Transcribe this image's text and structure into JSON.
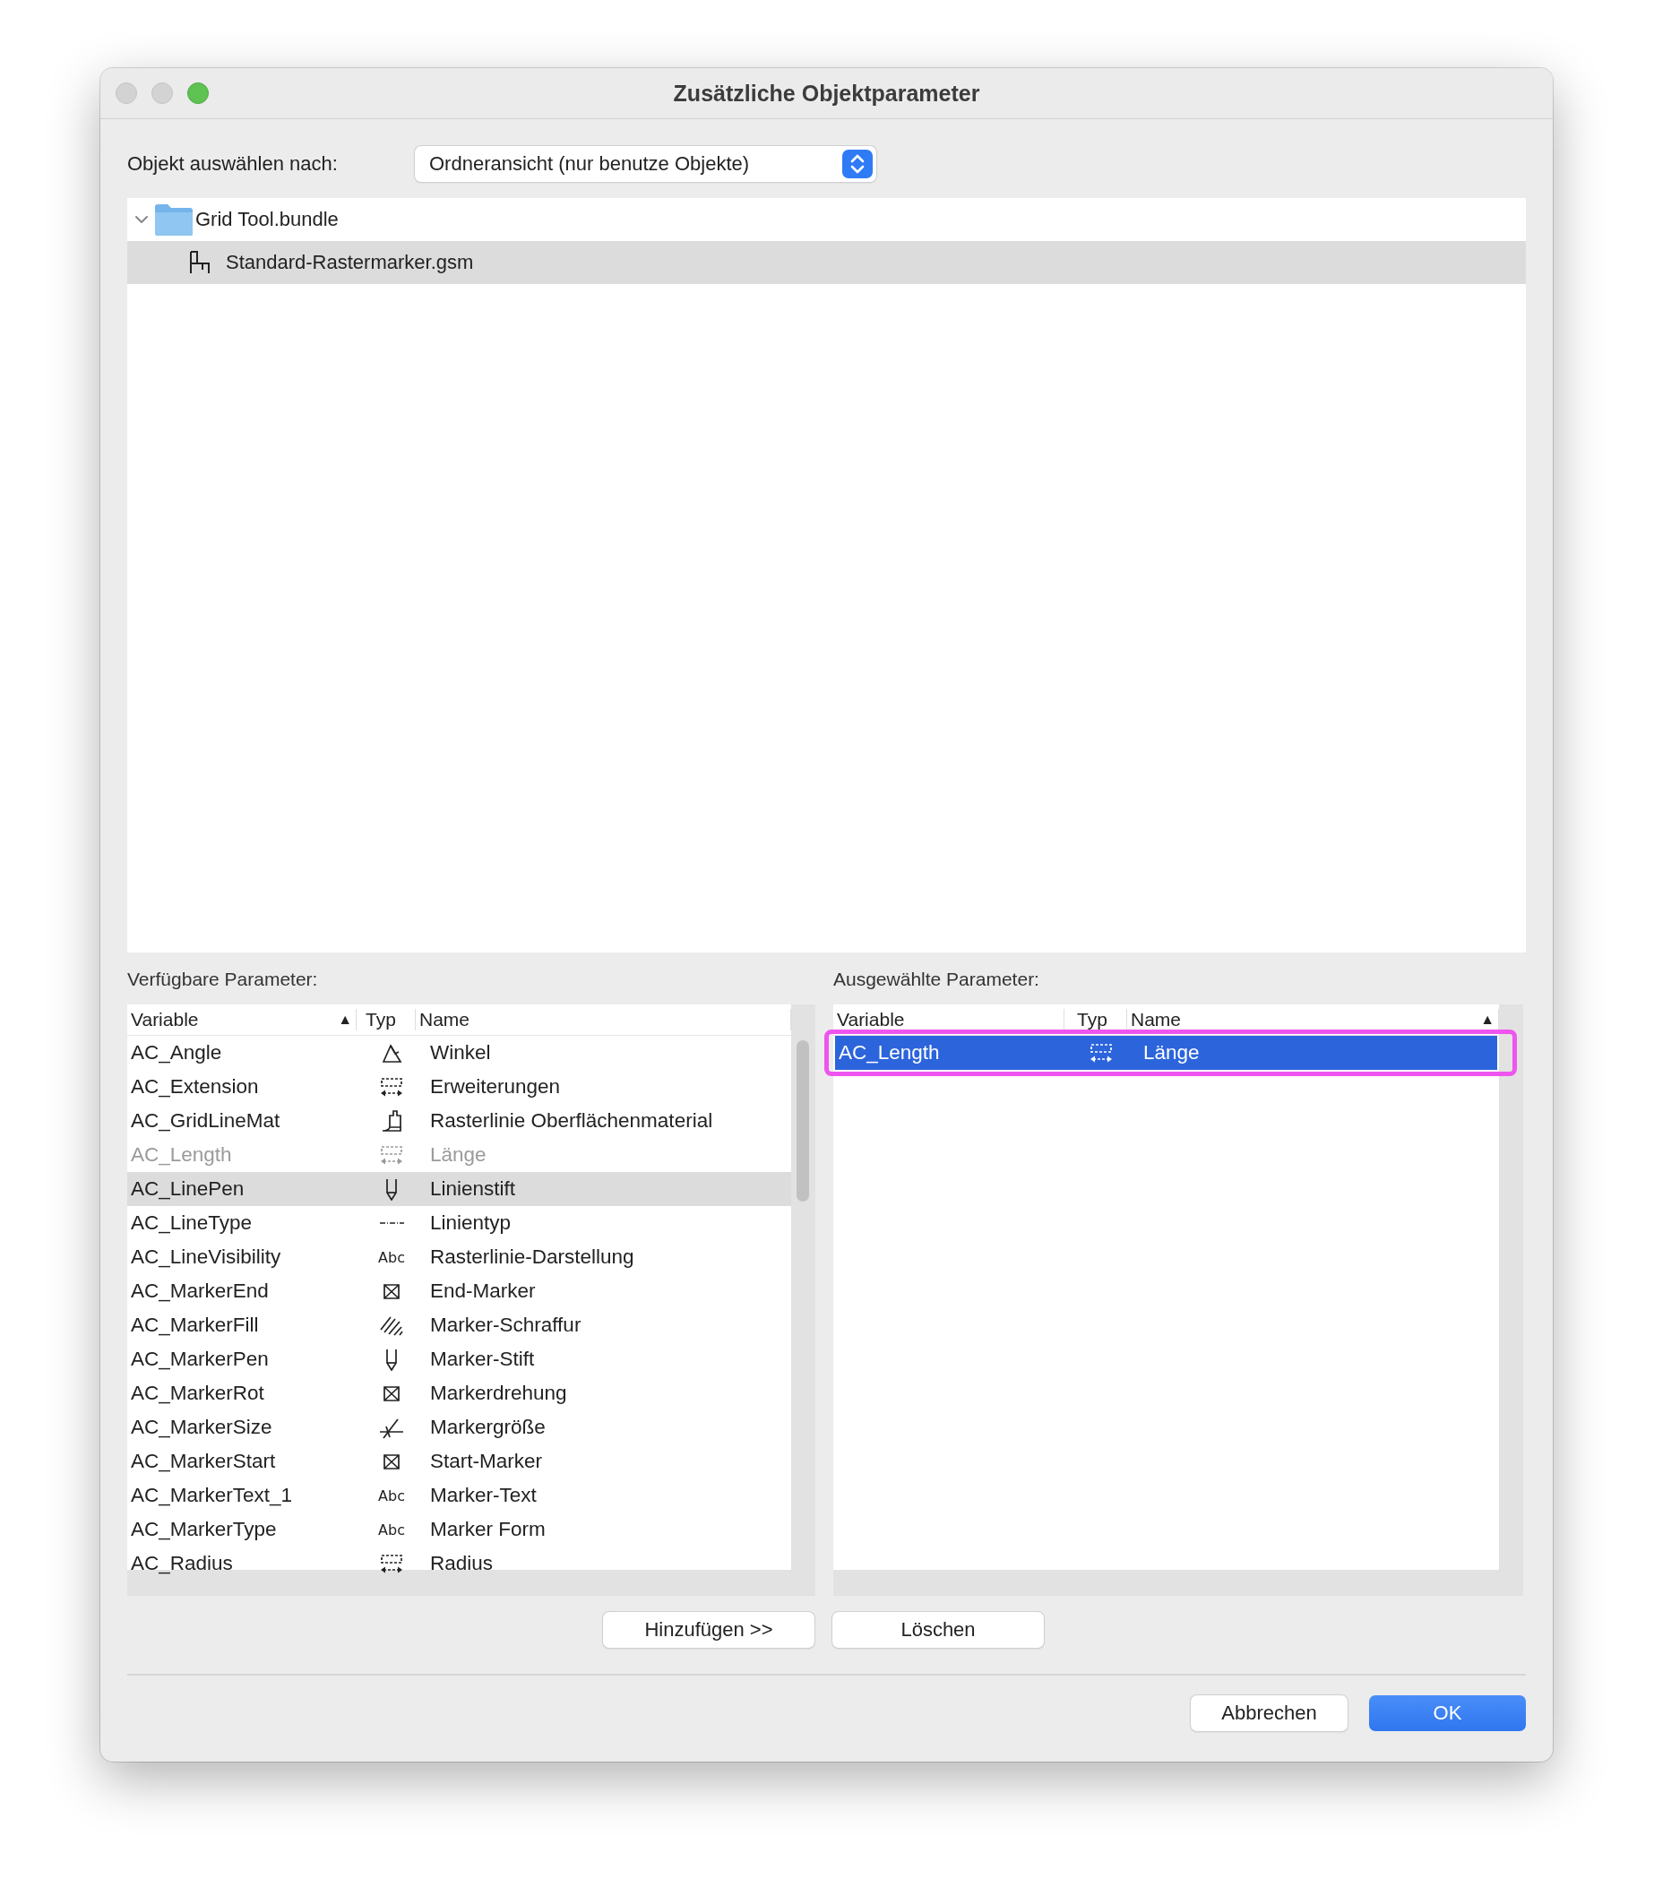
{
  "window": {
    "title": "Zusätzliche Objektparameter"
  },
  "selector": {
    "label": "Objekt auswählen nach:",
    "value": "Ordneransicht (nur benutze Objekte)"
  },
  "tree": [
    {
      "label": "Grid Tool.bundle",
      "kind": "folder",
      "expanded": true,
      "selected": false,
      "children": [
        {
          "label": "Standard-Rastermarker.gsm",
          "kind": "object",
          "selected": true
        }
      ]
    }
  ],
  "available": {
    "title": "Verfügbare Parameter:",
    "columns": [
      {
        "label": "Variable",
        "sort_indicator": "▲"
      },
      {
        "label": "Typ"
      },
      {
        "label": "Name"
      }
    ],
    "rows": [
      {
        "variable": "AC_Angle",
        "type": {
          "kind": "angle"
        },
        "name": "Winkel",
        "selected": false,
        "disabled": false
      },
      {
        "variable": "AC_Extension",
        "type": {
          "kind": "length"
        },
        "name": "Erweiterungen",
        "selected": false,
        "disabled": false
      },
      {
        "variable": "AC_GridLineMat",
        "type": {
          "kind": "material"
        },
        "name": "Rasterlinie Oberflächenmaterial",
        "selected": false,
        "disabled": false
      },
      {
        "variable": "AC_Length",
        "type": {
          "kind": "length"
        },
        "name": "Länge",
        "selected": false,
        "disabled": true
      },
      {
        "variable": "AC_LinePen",
        "type": {
          "kind": "pen"
        },
        "name": "Linienstift",
        "selected": true,
        "disabled": false
      },
      {
        "variable": "AC_LineType",
        "type": {
          "kind": "linetype"
        },
        "name": "Linientyp",
        "selected": false,
        "disabled": false
      },
      {
        "variable": "AC_LineVisibility",
        "type": {
          "kind": "text",
          "label": "Abc"
        },
        "name": "Rasterlinie-Darstellung",
        "selected": false,
        "disabled": false
      },
      {
        "variable": "AC_MarkerEnd",
        "type": {
          "kind": "marker"
        },
        "name": "End-Marker",
        "selected": false,
        "disabled": false
      },
      {
        "variable": "AC_MarkerFill",
        "type": {
          "kind": "fill"
        },
        "name": "Marker-Schraffur",
        "selected": false,
        "disabled": false
      },
      {
        "variable": "AC_MarkerPen",
        "type": {
          "kind": "pen"
        },
        "name": "Marker-Stift",
        "selected": false,
        "disabled": false
      },
      {
        "variable": "AC_MarkerRot",
        "type": {
          "kind": "marker"
        },
        "name": "Markerdrehung",
        "selected": false,
        "disabled": false
      },
      {
        "variable": "AC_MarkerSize",
        "type": {
          "kind": "size"
        },
        "name": "Markergröße",
        "selected": false,
        "disabled": false
      },
      {
        "variable": "AC_MarkerStart",
        "type": {
          "kind": "marker"
        },
        "name": "Start-Marker",
        "selected": false,
        "disabled": false
      },
      {
        "variable": "AC_MarkerText_1",
        "type": {
          "kind": "text",
          "label": "Abc"
        },
        "name": "Marker-Text",
        "selected": false,
        "disabled": false
      },
      {
        "variable": "AC_MarkerType",
        "type": {
          "kind": "text",
          "label": "Abc"
        },
        "name": "Marker Form",
        "selected": false,
        "disabled": false
      },
      {
        "variable": "AC_Radius",
        "type": {
          "kind": "length"
        },
        "name": "Radius",
        "selected": false,
        "disabled": false
      }
    ]
  },
  "chosen": {
    "title": "Ausgewählte Parameter:",
    "columns": [
      {
        "label": "Variable"
      },
      {
        "label": "Typ"
      },
      {
        "label": "Name",
        "sort_indicator": "▲"
      }
    ],
    "rows": [
      {
        "variable": "AC_Length",
        "type": {
          "kind": "length"
        },
        "name": "Länge",
        "selected": true,
        "disabled": false,
        "highlighted": true
      }
    ]
  },
  "buttons": [
    {
      "label": "Hinzufügen >>"
    },
    {
      "label": "Löschen"
    }
  ],
  "footer_buttons": [
    {
      "label": "Abbrechen",
      "kind": "default"
    },
    {
      "label": "OK",
      "kind": "primary"
    }
  ]
}
